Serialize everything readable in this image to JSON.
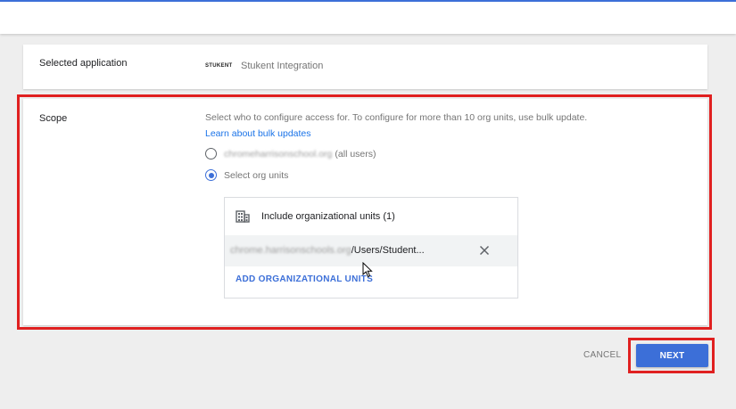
{
  "app_section": {
    "label": "Selected application",
    "logo_text": "STUKENT",
    "app_name": "Stukent Integration"
  },
  "scope": {
    "label": "Scope",
    "description": "Select who to configure access for. To configure for more than 10 org units, use bulk update.",
    "bulk_link": "Learn about bulk updates",
    "radio_all_domain": "chromeharrisonschool.org",
    "radio_all_suffix": "(all users)",
    "radio_select": "Select org units",
    "ou_panel": {
      "title": "Include organizational units (1)",
      "path_blurred": "chrome.harrisonschools.org",
      "path_visible": "/Users/Student...",
      "add_label": "ADD ORGANIZATIONAL UNITS"
    }
  },
  "footer": {
    "cancel_label": "CANCEL",
    "next_label": "NEXT"
  },
  "colors": {
    "accent": "#3c6fd8",
    "highlight": "#e02020",
    "link": "#1a73e8"
  }
}
